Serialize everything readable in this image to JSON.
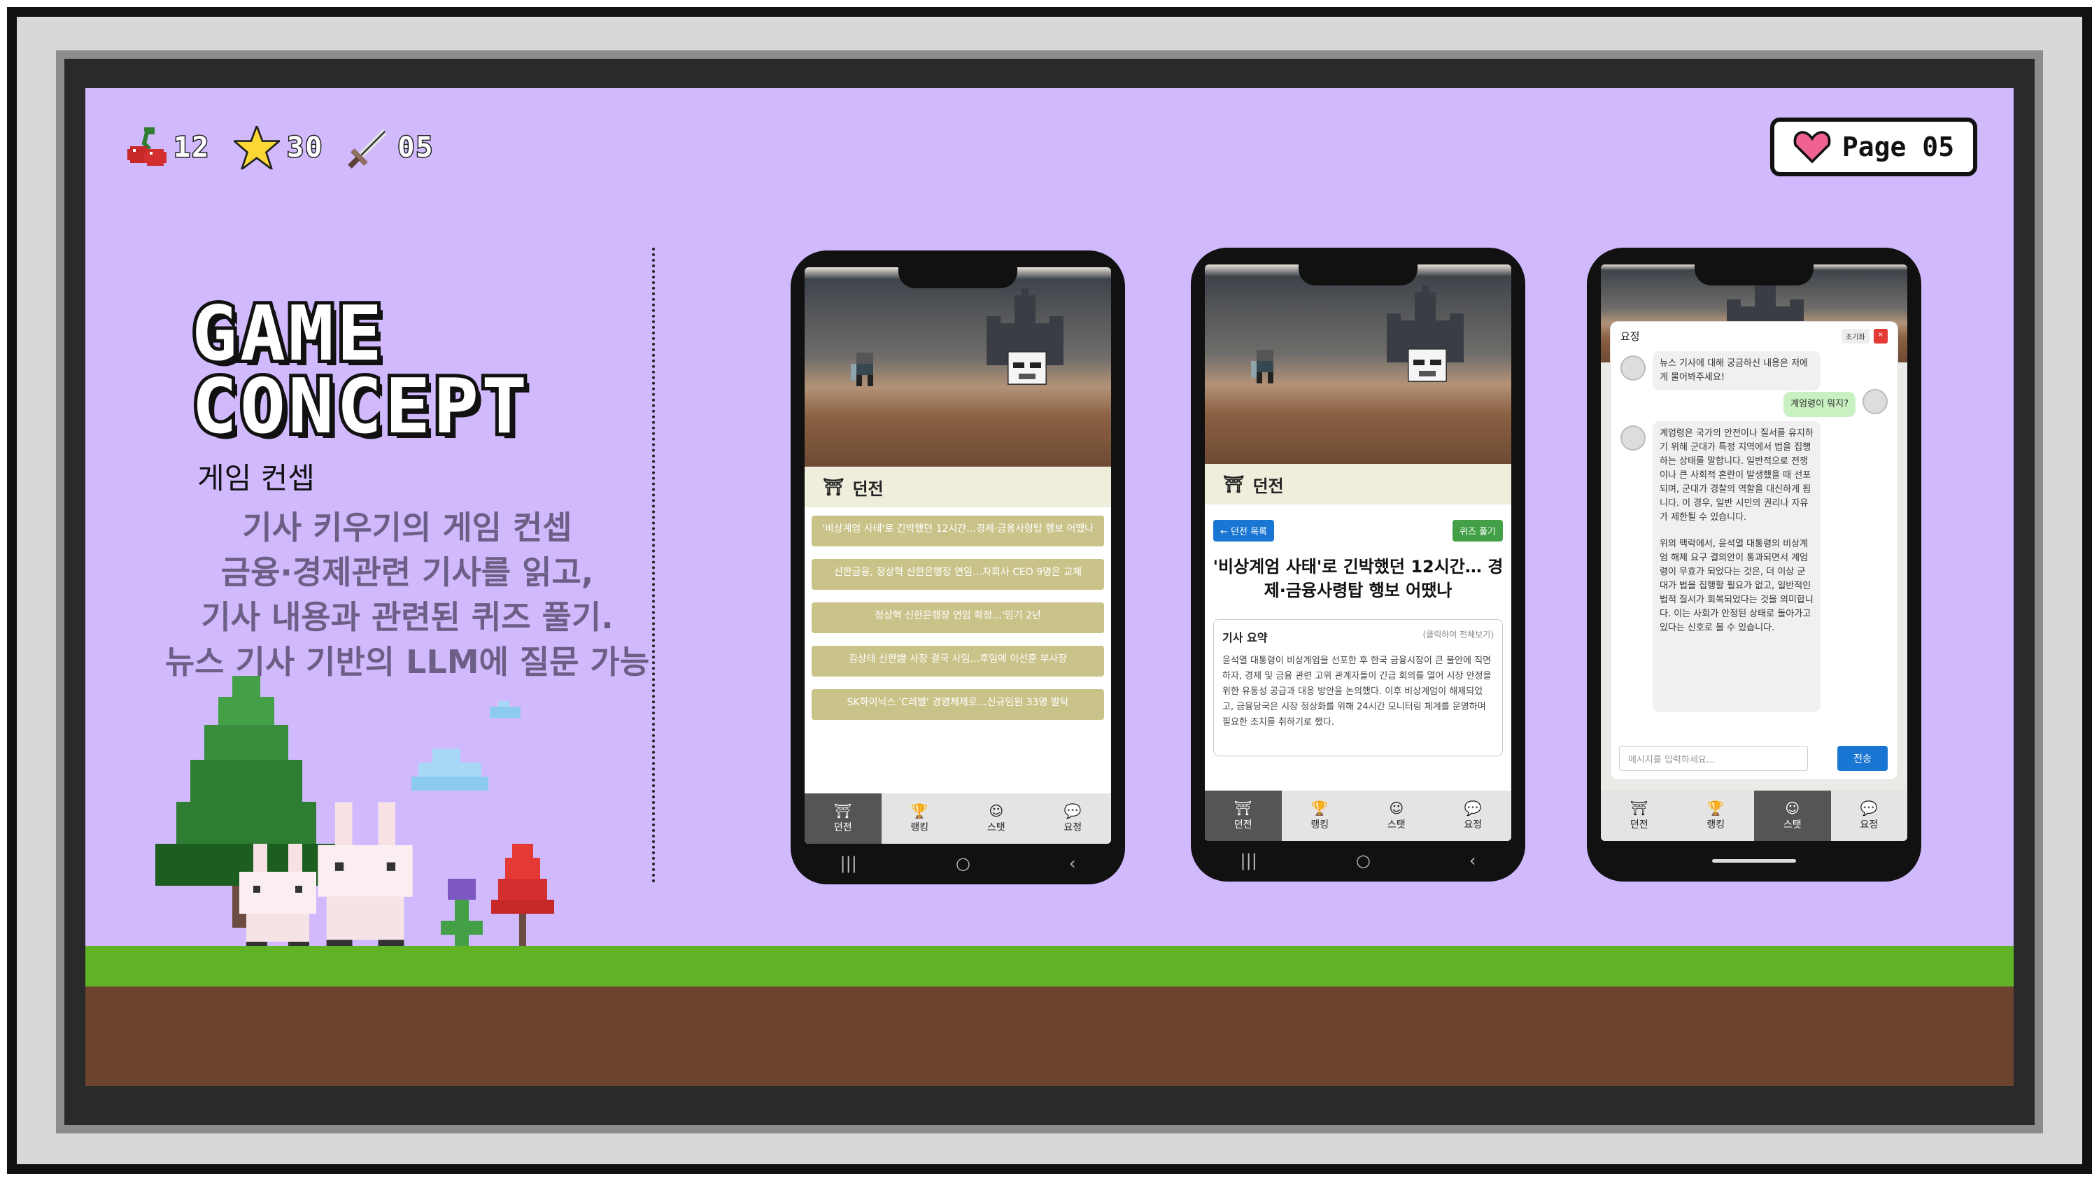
{
  "hud": {
    "cherries": "12",
    "stars": "30",
    "swords": "05",
    "icons": [
      "cherry-icon",
      "star-icon",
      "sword-icon"
    ]
  },
  "page": {
    "label": "Page 05",
    "icon": "heart-icon"
  },
  "title": {
    "line1": "GAME",
    "line2": "CONCEPT",
    "subtitle": "게임 컨셉"
  },
  "description": {
    "lines": [
      "기사 키우기의 게임 컨셉",
      "금융·경제관련 기사를 읽고,",
      "기사 내용과 관련된 퀴즈 풀기.",
      "뉴스 기사 기반의 LLM에 질문 가능"
    ]
  },
  "phone1": {
    "section": "던전",
    "articles": [
      "'비상계엄 사태'로 긴박했던 12시간…경제·금융사령탑 행보 어땠나",
      "신한금융, 정상혁 신한은행장 연임…자회사 CEO 9명은 교체",
      "정상혁 신한은행장 연임 확정…'임기 2년",
      "김상태 신한證 사장 결국 사임…후임에 이선훈 부사장",
      "SK하이닉스 'C레벨' 경영체제로…신규임원 33명 발탁"
    ],
    "tabs": [
      "던전",
      "랭킹",
      "스탯",
      "요정"
    ],
    "active_tab": "던전"
  },
  "phone2": {
    "section": "던전",
    "back_button": "← 던전 목록",
    "quiz_button": "퀴즈 풀기",
    "article_title": "'비상계엄 사태'로 긴박했던 12시간… 경제·금융사령탑 행보 어땠나",
    "summary_label": "기사 요약",
    "summary_hint": "(클릭하여 전체보기)",
    "summary_text": "윤석열 대통령이 비상계엄을 선포한 후 한국 금융시장이 큰 불안에 직면하자, 경제 및 금융 관련 고위 관계자들이 긴급 회의를 열어 시장 안정을 위한 유동성 공급과 대응 방안을 논의했다. 이후 비상계엄이 해제되었고, 금융당국은 시장 정상화를 위해 24시간 모니터링 체계를 운영하며 필요한 조치를 취하기로 했다.",
    "tabs": [
      "던전",
      "랭킹",
      "스탯",
      "요정"
    ],
    "active_tab": "던전"
  },
  "phone3": {
    "chat_title": "요정",
    "reset_button": "초기화",
    "close_button": "×",
    "messages": [
      "뉴스 기사에 대해 궁금하신 내용은 저에게 물어봐주세요!",
      "계엄령이 뭐지?",
      "계엄령은 국가의 안전이나 질서를 유지하기 위해 군대가 특정 지역에서 법을 집행하는 상태를 말합니다. 일반적으로 전쟁이나 큰 사회적 혼란이 발생했을 때 선포되며, 군대가 경찰의 역할을 대신하게 됩니다. 이 경우, 일반 시민의 권리나 자유가 제한될 수 있습니다.",
      "위의 맥락에서, 윤석열 대통령의 비상계엄 해제 요구 결의안이 통과되면서 계엄령이 무효가 되었다는 것은, 더 이상 군대가 법을 집행할 필요가 없고, 일반적인 법적 질서가 회복되었다는 것을 의미합니다. 이는 사회가 안정된 상태로 돌아가고 있다는 신호로 볼 수 있습니다."
    ],
    "input_placeholder": "메시지를 입력하세요...",
    "send_button": "전송",
    "tabs": [
      "던전",
      "랭킹",
      "스탯",
      "요정"
    ],
    "active_tab": "스탯"
  },
  "colors": {
    "background": "#d0b9fd",
    "grass": "#5fb325",
    "dirt": "#6b432e",
    "article_item": "#c9c38a",
    "back_button": "#1976d2",
    "quiz_button": "#43a047",
    "send_button": "#1976d2"
  }
}
